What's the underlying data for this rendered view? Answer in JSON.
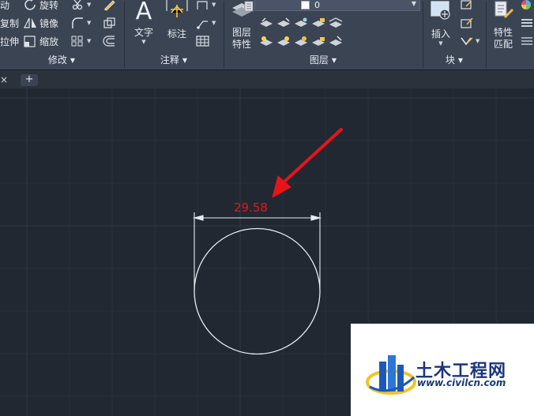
{
  "ribbon": {
    "modify": {
      "title": "修改",
      "move": "动",
      "rotate": "旋转",
      "copy": "复制",
      "mirror": "镜像",
      "stretch": "拉伸",
      "scale": "缩放"
    },
    "annotation": {
      "title": "注释",
      "text": "文字",
      "dimension": "标注"
    },
    "layers": {
      "title": "图层",
      "properties_line1": "图层",
      "properties_line2": "特性",
      "current_layer": "0"
    },
    "block": {
      "title": "块",
      "insert": "插入"
    },
    "properties": {
      "match_line1": "特性",
      "match_line2": "匹配"
    }
  },
  "tabs": {
    "close_glyph": "×",
    "new_glyph": "+"
  },
  "drawing": {
    "dimension_value": "29.58",
    "line_color": "#e9ecef",
    "arrow_color": "#e8141a",
    "background": "#212832"
  },
  "watermark": {
    "title": "土木工程网",
    "url": "www.civilcn.com"
  }
}
